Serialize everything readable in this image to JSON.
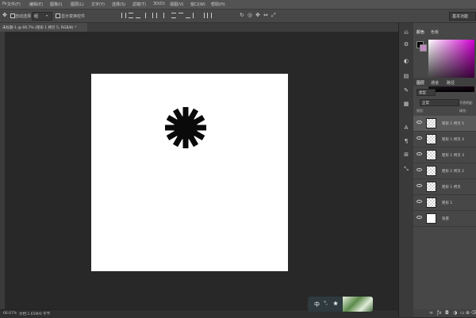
{
  "menu": {
    "items": [
      "文件(F)",
      "编辑(E)",
      "图像(I)",
      "图层(L)",
      "文字(Y)",
      "选择(S)",
      "滤镜(T)",
      "3D(D)",
      "视图(V)",
      "窗口(W)",
      "帮助(H)"
    ]
  },
  "options": {
    "auto_select_label": "自动选择：",
    "auto_select_value": "组",
    "transform_label": "显示变换控件",
    "workspace": "基本功能"
  },
  "document": {
    "tab_title": "未标题-1 @ 66.7% (矩形 1 拷贝 5, RGB/8) *"
  },
  "status": {
    "doc_info": "文档:1.65M/0 字节"
  },
  "panels": {
    "color_tabs": [
      "颜色",
      "色板"
    ],
    "layer_tabs": [
      "图层",
      "通道",
      "路径"
    ],
    "filter_kind": "类型",
    "blend_mode": "正常",
    "opacity_label": "不透明度:",
    "lock_label": "锁定:",
    "fill_label": "填充:"
  },
  "layers": [
    {
      "name": "矩形 1 拷贝 5",
      "type": "shape"
    },
    {
      "name": "矩形 1 拷贝 4",
      "type": "shape"
    },
    {
      "name": "矩形 1 拷贝 3",
      "type": "shape"
    },
    {
      "name": "矩形 1 拷贝 2",
      "type": "shape"
    },
    {
      "name": "矩形 1 拷贝",
      "type": "shape"
    },
    {
      "name": "矩形 1",
      "type": "shape"
    },
    {
      "name": "背景",
      "type": "background"
    }
  ],
  "ime": {
    "label": "中"
  },
  "colors": {
    "menubar": "#535353",
    "workspace": "#282828",
    "panel": "#474747",
    "canvas": "#ffffff",
    "shape": "#0a0a0a",
    "selected_layer": "#5a5a5a"
  }
}
